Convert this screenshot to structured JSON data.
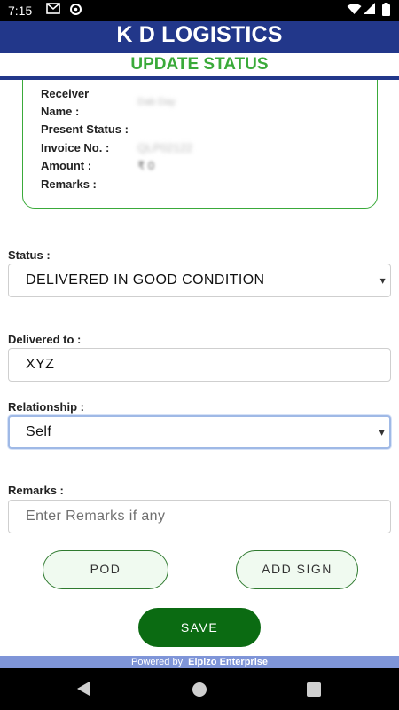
{
  "status_bar": {
    "time": "7:15",
    "icons": [
      "gmail-icon",
      "sync-icon",
      "wifi-icon",
      "cellular-icon",
      "battery-icon"
    ]
  },
  "header": {
    "title": "K D LOGISTICS",
    "subtitle": "UPDATE STATUS"
  },
  "info_card": {
    "receiver_label_line1": "Receiver",
    "receiver_label_line2": "Name :",
    "receiver_value": "Dab Day",
    "present_status_label": "Present Status :",
    "invoice_label": "Invoice No. :",
    "invoice_value": "QLP02122",
    "amount_label": "Amount :",
    "amount_value": "₹ 0",
    "remarks_label": "Remarks :"
  },
  "form": {
    "status_label": "Status :",
    "status_value": "DELIVERED IN GOOD CONDITION",
    "delivered_to_label": "Delivered to :",
    "delivered_to_value": "XYZ",
    "relationship_label": "Relationship :",
    "relationship_value": "Self",
    "remarks_label": "Remarks :",
    "remarks_placeholder": "Enter Remarks if any"
  },
  "buttons": {
    "pod": "POD",
    "add_sign": "ADD SIGN",
    "save": "SAVE"
  },
  "footer": {
    "prefix": "Powered by",
    "brand": "Elpizo Enterprise"
  },
  "colors": {
    "header_bg": "#22378a",
    "subtitle_green": "#3aaa3a",
    "save_green": "#0b6b12",
    "footer_bg": "#7f95d8"
  }
}
